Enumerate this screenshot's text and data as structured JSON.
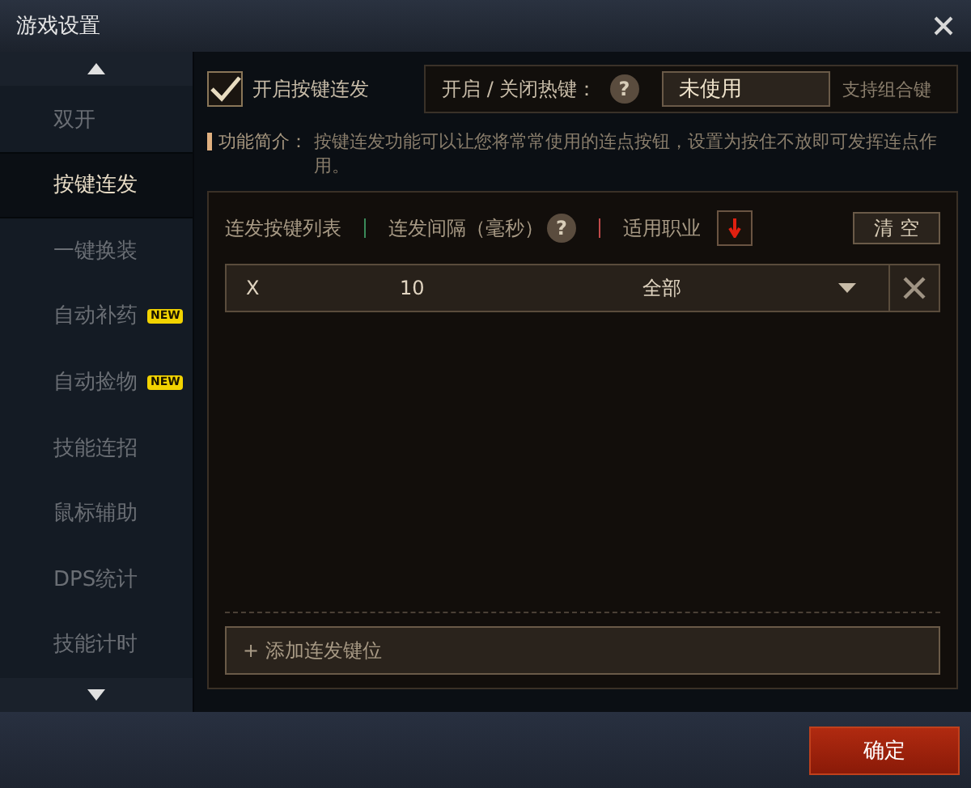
{
  "window": {
    "title": "游戏设置"
  },
  "sidebar": {
    "items": [
      {
        "label": "双开",
        "selected": false
      },
      {
        "label": "按键连发",
        "selected": true
      },
      {
        "label": "一键换装",
        "selected": false
      },
      {
        "label": "自动补药",
        "selected": false,
        "badge": "NEW"
      },
      {
        "label": "自动捡物",
        "selected": false,
        "badge": "NEW"
      },
      {
        "label": "技能连招",
        "selected": false
      },
      {
        "label": "鼠标辅助",
        "selected": false
      },
      {
        "label": "DPS统计",
        "selected": false
      },
      {
        "label": "技能计时",
        "selected": false
      }
    ]
  },
  "enable": {
    "label": "开启按键连发",
    "checked": true
  },
  "hotkey": {
    "label": "开启 / 关闭热键：",
    "help": "?",
    "value": "未使用",
    "hint": "支持组合键"
  },
  "description": {
    "label": "功能简介：",
    "text": "按键连发功能可以让您将常常使用的连点按钮，设置为按住不放即可发挥连点作用。"
  },
  "table": {
    "columns": [
      {
        "label": "连发按键列表"
      },
      {
        "label": "连发间隔（毫秒）",
        "help": "?"
      },
      {
        "label": "适用职业"
      }
    ],
    "clear_button": "清 空",
    "rows": [
      {
        "key": "X",
        "interval": "10",
        "class": "全部"
      }
    ]
  },
  "add_button": "+ 添加连发键位",
  "buttons": {
    "ok": "确定"
  }
}
